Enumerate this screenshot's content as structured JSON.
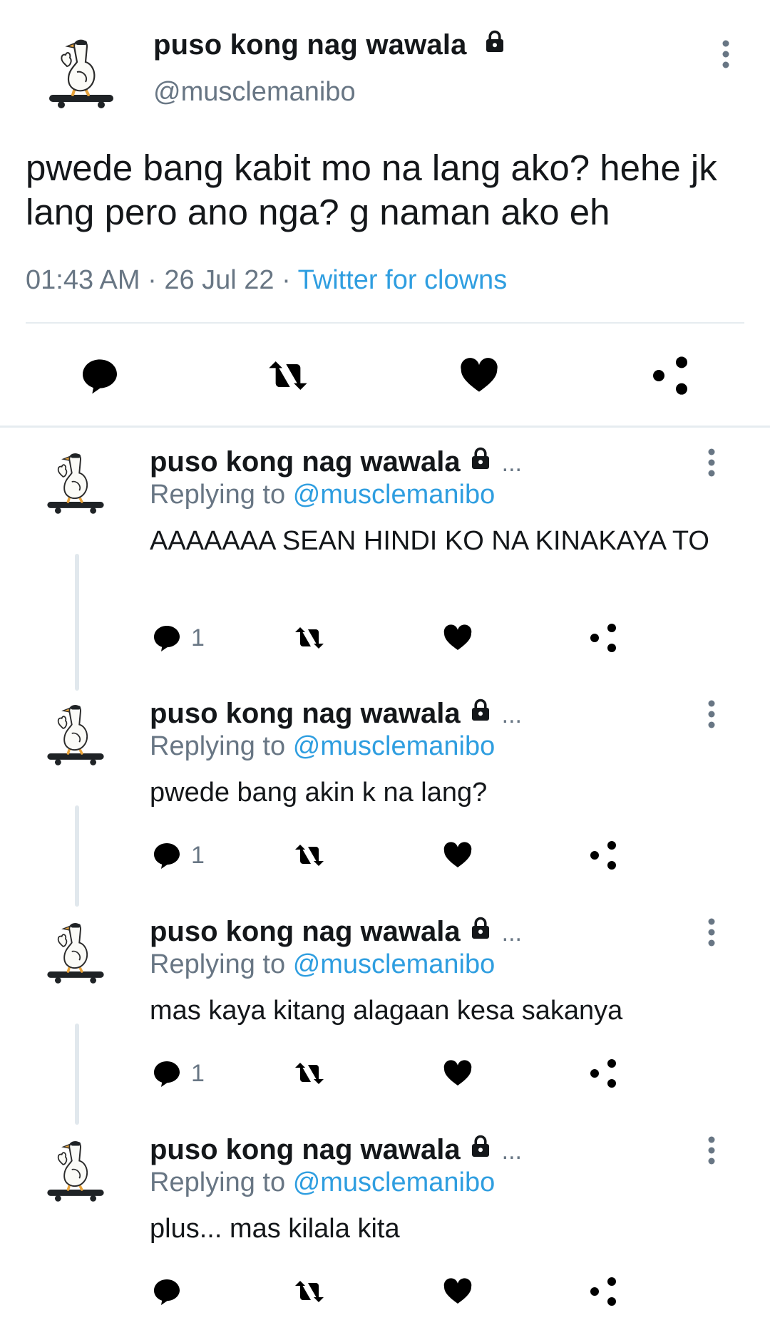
{
  "tweet": {
    "display_name": "puso kong nag wawala",
    "handle": "@musclemanibo",
    "text": "pwede bang kabit mo na lang ako? hehe jk lang pero ano nga? g naman ako eh",
    "time": "01:43 AM",
    "date": "26 Jul 22",
    "source": "Twitter for clowns",
    "dot": "·"
  },
  "replies": [
    {
      "display_name": "puso kong nag wawala",
      "ellipsis": "...",
      "replying_label": "Replying to",
      "replying_handle": "@musclemanibo",
      "text": "AAAAAAA SEAN HINDI KO NA KINAKAYA TO",
      "reply_count": "1"
    },
    {
      "display_name": "puso kong nag wawala",
      "ellipsis": "...",
      "replying_label": "Replying to",
      "replying_handle": "@musclemanibo",
      "text": "pwede bang akin k na lang?",
      "reply_count": "1"
    },
    {
      "display_name": "puso kong nag wawala",
      "ellipsis": "...",
      "replying_label": "Replying to",
      "replying_handle": "@musclemanibo",
      "text": "mas kaya kitang alagaan kesa sakanya",
      "reply_count": "1"
    },
    {
      "display_name": "puso kong nag wawala",
      "ellipsis": "...",
      "replying_label": "Replying to",
      "replying_handle": "@musclemanibo",
      "text": "plus... mas kilala kita",
      "reply_count": ""
    }
  ],
  "icons": {
    "reply": "reply-icon",
    "retweet": "retweet-icon",
    "like": "heart-icon",
    "share": "share-icon",
    "more": "more-vertical-icon",
    "lock": "lock-icon",
    "avatar": "goose-skateboard-avatar"
  },
  "colors": {
    "link": "#2f9ee0",
    "muted": "#687684",
    "text": "#14171a",
    "separator": "#e6ecf0"
  }
}
